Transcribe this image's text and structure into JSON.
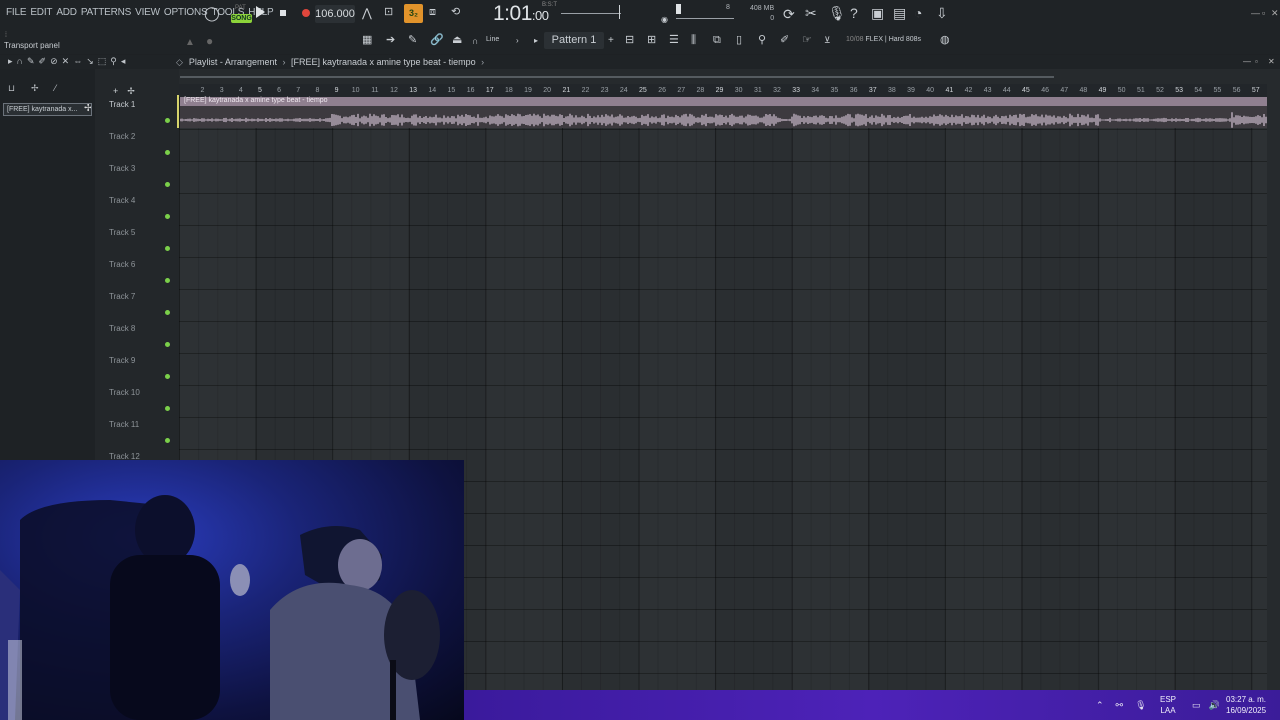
{
  "menu": [
    "FILE",
    "EDIT",
    "ADD",
    "PATTERNS",
    "VIEW",
    "OPTIONS",
    "TOOLS",
    "HELP"
  ],
  "transport": {
    "song_badge": "SONG",
    "pat_label": "PAT",
    "tempo": "106.000",
    "mini_toggle": "3₂",
    "time_main": "1:01",
    "time_ticks": ":00",
    "time_sig": "B:S:T",
    "cpu_value": "8",
    "mem_top": "408 MB",
    "mem_bottom": "0"
  },
  "toolbar2": {
    "transport_panel": "Transport panel",
    "snap": "Line",
    "pattern": "Pattern 1",
    "flex_count": "10/08",
    "flex_name": "FLEX | Hard 808s"
  },
  "playlist": {
    "title": "Playlist - Arrangement",
    "project": "[FREE] kaytranada x amine type beat - tiempo",
    "clip_item": "[FREE] kaytranada x...",
    "clip_label": "[FREE] kaytranada x amine type beat - tiempo",
    "tracks": [
      "Track 1",
      "Track 2",
      "Track 3",
      "Track 4",
      "Track 5",
      "Track 6",
      "Track 7",
      "Track 8",
      "Track 9",
      "Track 10",
      "Track 11",
      "Track 12"
    ],
    "ruler": [
      "2",
      "3",
      "4",
      "5",
      "6",
      "7",
      "8",
      "9",
      "10",
      "11",
      "12",
      "13",
      "14",
      "15",
      "16",
      "17",
      "18",
      "19",
      "20",
      "21",
      "22",
      "23",
      "24",
      "25",
      "26",
      "27",
      "28",
      "29",
      "30",
      "31",
      "32",
      "33",
      "34",
      "35",
      "36",
      "37",
      "38",
      "39",
      "40",
      "41",
      "42",
      "43",
      "44",
      "45",
      "46",
      "47",
      "48",
      "49",
      "50",
      "51",
      "52",
      "53",
      "54",
      "55",
      "56",
      "57"
    ]
  },
  "taskbar": {
    "lang_top": "ESP",
    "lang_bottom": "LAA",
    "time": "03:27 a. m.",
    "date": "16/09/2025"
  },
  "colors": {
    "accent_song": "#8dd43a",
    "accent_orange": "#e1932b",
    "record": "#e0463c",
    "track_dot": "#7bd04a",
    "clip_header": "#8f7f8f",
    "taskbar": "#4d22b8"
  },
  "icons": [
    "loop-icon",
    "metronome-icon",
    "wait-icon",
    "countdown-icon",
    "undo-icon",
    "cut-icon",
    "mic-icon",
    "help-icon",
    "save-icon",
    "render-icon",
    "chat-icon",
    "download-icon",
    "piano-roll-icon",
    "arrow-icon",
    "link-icon",
    "stamp-icon",
    "magnet-icon",
    "mixer-icon",
    "channel-rack-icon",
    "browser-icon",
    "plugin-icon",
    "cart-icon",
    "globe-icon",
    "pencil-icon",
    "brush-icon",
    "delete-icon",
    "mute-icon",
    "slice-icon",
    "select-icon",
    "zoom-icon",
    "speaker-icon"
  ]
}
